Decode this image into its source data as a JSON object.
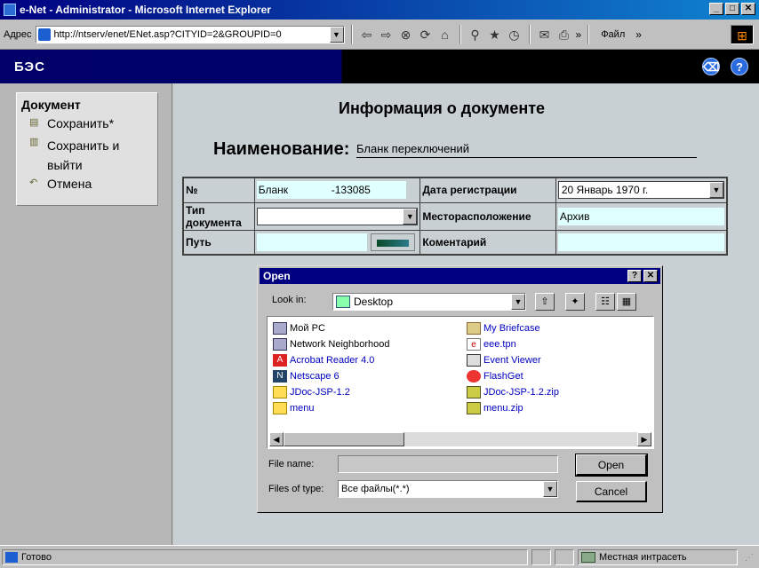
{
  "window": {
    "title": "e-Net - Administrator - Microsoft Internet Explorer",
    "buttons": {
      "minimize": "_",
      "maximize": "□",
      "close": "✕"
    }
  },
  "toolbar": {
    "address_label": "Адрес",
    "address_value": "http://ntserv/enet/ENet.asp?CITYID=2&GROUPID=0",
    "file_menu": "Файл",
    "chevron": "»"
  },
  "app": {
    "title": "БЭС",
    "icons": [
      "eraser-icon",
      "help-icon"
    ]
  },
  "sidebar": {
    "heading": "Документ",
    "actions": [
      {
        "label": "Сохранить*",
        "icon": "save-icon"
      },
      {
        "label": "Сохранить и выйти",
        "icon": "save-exit-icon"
      },
      {
        "label": "Отмена",
        "icon": "undo-icon"
      }
    ]
  },
  "document": {
    "heading": "Информация о документе",
    "name_label": "Наименование:",
    "name_value": "Бланк переключений",
    "fields": {
      "number_label": "№",
      "number_value": "Бланк",
      "number_suffix": "-133085",
      "reg_date_label": "Дата регистрации",
      "reg_date_value": "20  Январь  1970 г.",
      "doc_type_label": "Тип документа",
      "doc_type_value": "",
      "location_label": "Месторасположение",
      "location_value": "Архив",
      "path_label": "Путь",
      "path_value": "",
      "comment_label": "Коментарий",
      "comment_value": ""
    }
  },
  "dialog": {
    "title": "Open",
    "help": "?",
    "close": "✕",
    "look_in_label": "Look in:",
    "look_in_value": "Desktop",
    "files_left": [
      {
        "name": "Мой PC",
        "icon": "computer-icon"
      },
      {
        "name": "Network Neighborhood",
        "icon": "network-icon"
      },
      {
        "name": "Acrobat Reader 4.0",
        "icon": "acrobat-icon"
      },
      {
        "name": "Netscape 6",
        "icon": "netscape-icon"
      },
      {
        "name": "JDoc-JSP-1.2",
        "icon": "folder-icon"
      },
      {
        "name": "menu",
        "icon": "folder-icon"
      }
    ],
    "files_right": [
      {
        "name": "My Briefcase",
        "icon": "briefcase-icon"
      },
      {
        "name": "eee.tpn",
        "icon": "file-icon"
      },
      {
        "name": "Event Viewer",
        "icon": "event-viewer-icon"
      },
      {
        "name": "FlashGet",
        "icon": "flashget-icon"
      },
      {
        "name": "JDoc-JSP-1.2.zip",
        "icon": "zip-icon"
      },
      {
        "name": "menu.zip",
        "icon": "zip-icon"
      }
    ],
    "file_name_label": "File name:",
    "file_name_value": "",
    "file_type_label": "Files of type:",
    "file_type_value": "Все файлы(*.*)",
    "open_button": "Open",
    "cancel_button": "Cancel"
  },
  "status": {
    "left": "Готово",
    "zone": "Местная интрасеть"
  }
}
